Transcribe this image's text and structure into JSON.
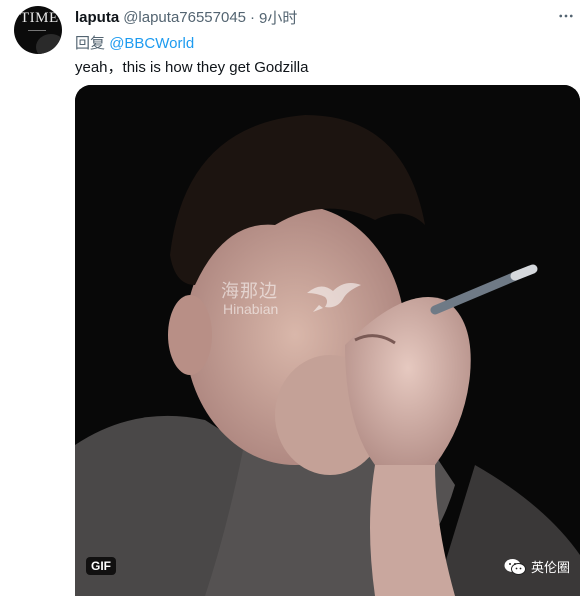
{
  "author": {
    "display_name": "laputa",
    "handle": "@laputa76557045",
    "time": "9小时",
    "avatar_text": "TIME"
  },
  "meta": {
    "separator": "·"
  },
  "reply": {
    "prefix": "回复",
    "target": "@BBCWorld"
  },
  "tweet": {
    "text": "yeah，this is how they get Godzilla"
  },
  "media": {
    "type": "gif",
    "badge": "GIF",
    "watermark_cn": "海那边",
    "watermark_en": "Hinabian",
    "source_label": "英伦圈"
  },
  "icons": {
    "more": "more-horizontal-icon",
    "wechat": "wechat-icon",
    "bird": "bird-logo-icon"
  }
}
